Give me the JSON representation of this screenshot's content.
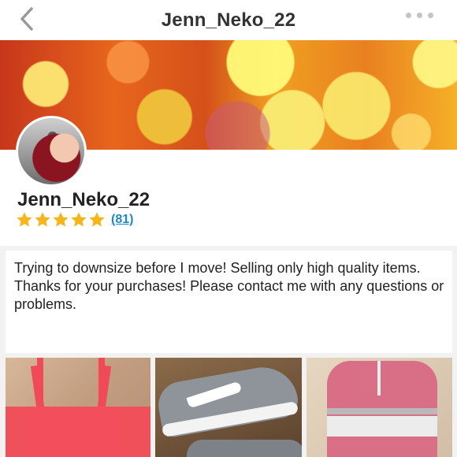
{
  "header": {
    "title": "Jenn_Neko_22",
    "back_icon": "chevron-left-icon",
    "more_icon": "more-horizontal-icon"
  },
  "profile": {
    "username": "Jenn_Neko_22",
    "rating_stars": 5,
    "rating_max": 5,
    "review_count": "(81)",
    "star_color": "#f5b51b",
    "link_color": "#1e88c8"
  },
  "bio": {
    "text": "Trying to downsize before I move! Selling only high quality items.  Thanks for your purchases!  Please contact me with any questions or problems."
  },
  "listings": [
    {
      "item": "pink sports bra"
    },
    {
      "item": "gray sneakers"
    },
    {
      "item": "pink hoodie"
    }
  ]
}
